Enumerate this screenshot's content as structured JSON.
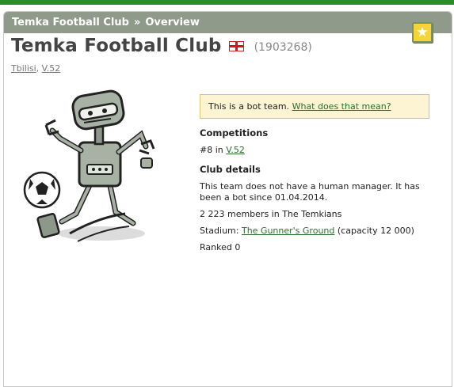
{
  "breadcrumb": {
    "club": "Temka Football Club",
    "separator": "»",
    "page": "Overview"
  },
  "club": {
    "name": "Temka Football Club",
    "flag": "georgia-flag",
    "id": "(1903268)",
    "city": "Tbilisi",
    "league": "V.52"
  },
  "bot_notice": {
    "text": "This is a bot team.",
    "link": "What does that mean?"
  },
  "competitions": {
    "title": "Competitions",
    "position": "#8 in",
    "league": "V.52"
  },
  "club_details": {
    "title": "Club details",
    "manager_text": "This team does not have a human manager. It has been a bot since 01.04.2014.",
    "members": "2 223 members in The Temkians",
    "stadium_label": "Stadium:",
    "stadium_name": "The Gunner's Ground",
    "stadium_capacity": "(capacity 12 000)",
    "ranked": "Ranked 0"
  },
  "icons": {
    "star": "star-icon",
    "mascot": "robot-mascot-image"
  },
  "colors": {
    "topbar": "#2f8a2f",
    "header": "#8f9a8b",
    "link": "#2d6e2d",
    "notice_bg": "#fdf4d4"
  }
}
